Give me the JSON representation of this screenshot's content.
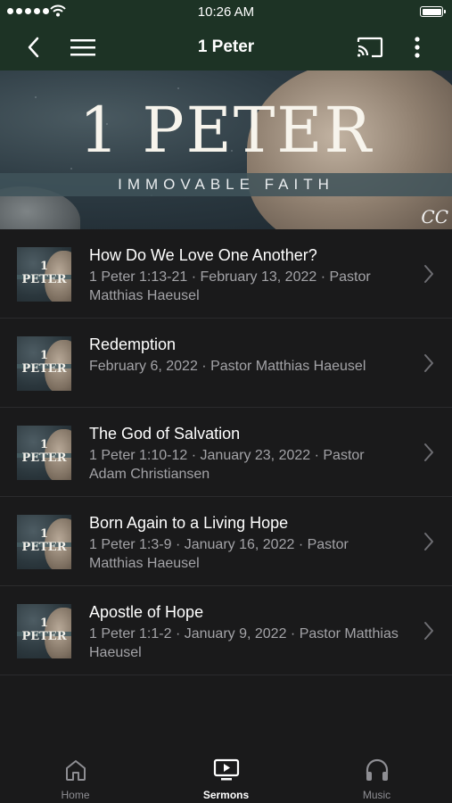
{
  "status_bar": {
    "time": "10:26 AM"
  },
  "nav": {
    "title": "1 Peter"
  },
  "hero": {
    "title": "1 PETER",
    "subtitle": "IMMOVABLE FAITH",
    "logo": "CC"
  },
  "thumbnail": {
    "title": "1 PETER"
  },
  "sermons": [
    {
      "title": "How Do We Love One Another?",
      "meta": "1 Peter 1:13-21 · February 13, 2022 · Pastor Matthias Haeusel"
    },
    {
      "title": "Redemption",
      "meta": "February 6, 2022 · Pastor Matthias Haeusel"
    },
    {
      "title": "The God of Salvation",
      "meta": "1 Peter 1:10-12 · January 23, 2022 · Pastor Adam Christiansen"
    },
    {
      "title": "Born Again to a Living Hope",
      "meta": "1 Peter 1:3-9 · January 16, 2022 · Pastor Matthias Haeusel"
    },
    {
      "title": "Apostle of Hope",
      "meta": "1 Peter 1:1-2 · January 9, 2022 · Pastor Matthias Haeusel"
    }
  ],
  "tabs": [
    {
      "label": "Home",
      "icon": "home-icon",
      "active": false
    },
    {
      "label": "Sermons",
      "icon": "play-screen-icon",
      "active": true
    },
    {
      "label": "Music",
      "icon": "headphones-icon",
      "active": false
    }
  ],
  "colors": {
    "header": "#1d3325",
    "background": "#1a1a1b",
    "meta_text": "#a3a3a7",
    "inactive_tab": "#8e8e93"
  }
}
